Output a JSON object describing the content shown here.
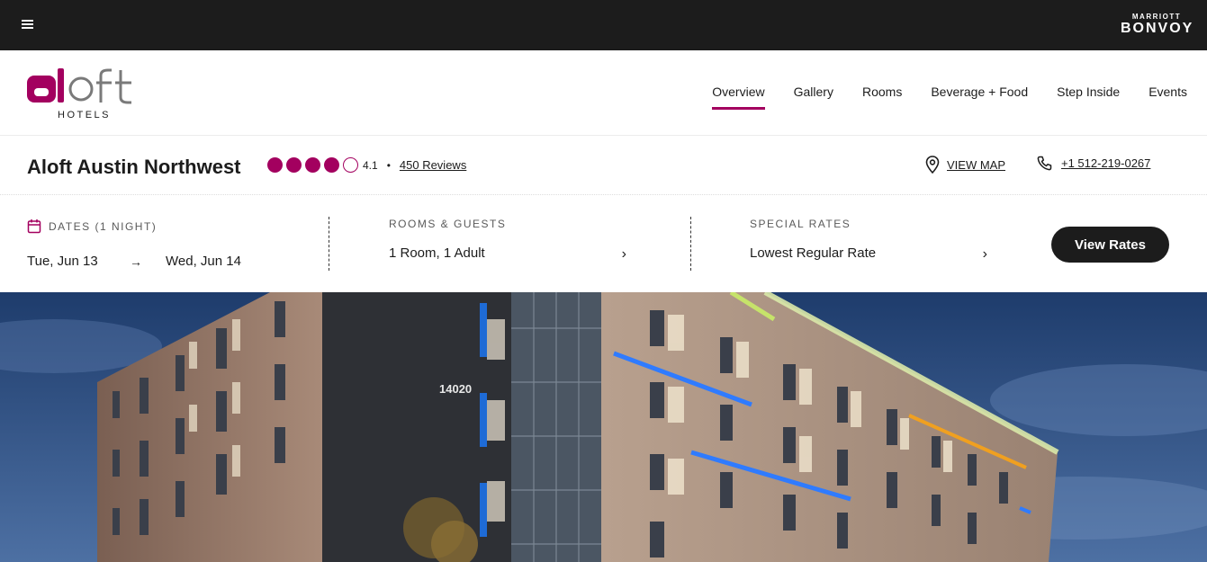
{
  "topbar": {
    "menu_icon": "hamburger-icon",
    "brand_top": "MARRIOTT",
    "brand_main": "BONVOY"
  },
  "header": {
    "logo_text": "aloft",
    "logo_tagline": "HOTELS",
    "nav": [
      {
        "label": "Overview",
        "active": true
      },
      {
        "label": "Gallery",
        "active": false
      },
      {
        "label": "Rooms",
        "active": false
      },
      {
        "label": "Beverage + Food",
        "active": false
      },
      {
        "label": "Step Inside",
        "active": false
      },
      {
        "label": "Events",
        "active": false
      }
    ]
  },
  "property": {
    "name": "Aloft Austin Northwest",
    "rating_value": "4.1",
    "rating_dots_filled": 4,
    "rating_dots_total": 5,
    "bullet": "•",
    "reviews_label": "450 Reviews",
    "map_label": "VIEW MAP",
    "map_icon": "location-pin-icon",
    "phone_label": "+1 512-219-0267",
    "phone_icon": "phone-icon"
  },
  "booking": {
    "dates_label": "DATES (1 NIGHT)",
    "calendar_icon": "calendar-icon",
    "check_in": "Tue, Jun 13",
    "arrow": "→",
    "check_out": "Wed, Jun 14",
    "rooms_label": "ROOMS & GUESTS",
    "rooms_value": "1 Room, 1 Adult",
    "rates_label": "SPECIAL RATES",
    "rates_value": "Lowest Regular Rate",
    "chevron": "›",
    "cta": "View Rates"
  },
  "hero": {
    "building_number": "14020"
  },
  "colors": {
    "brand": "#a3005f",
    "dark": "#1c1c1c",
    "sky": "#2b4f85"
  }
}
